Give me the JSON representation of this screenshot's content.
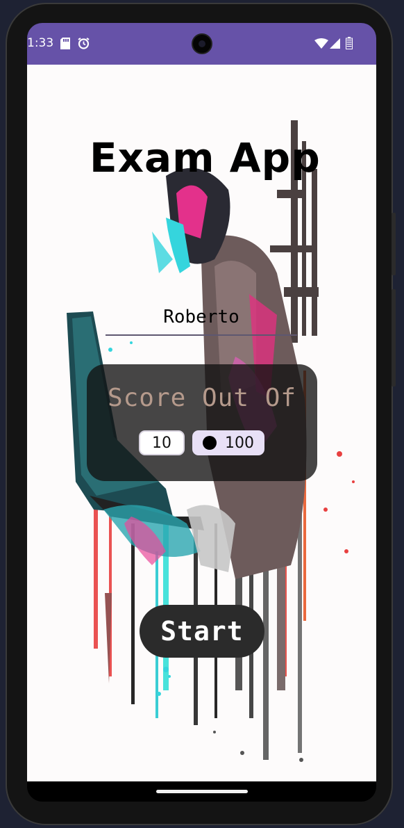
{
  "status_bar": {
    "time": "1:33",
    "icons": [
      "sd-card-icon",
      "alarm-icon",
      "wifi-icon",
      "cell-signal-icon",
      "battery-icon"
    ],
    "color": "#6652a8"
  },
  "app": {
    "title": "Exam App",
    "name_input": {
      "value": "Roberto",
      "placeholder": ""
    },
    "score": {
      "label": "Score Out Of",
      "options": [
        "10",
        "100"
      ],
      "selected": "100"
    },
    "start_label": "Start"
  },
  "colors": {
    "card_bg": "#121212",
    "label_color": "#b59a8c",
    "selected_option_bg": "#e8e0f6",
    "button_bg": "#2b2b2b"
  }
}
